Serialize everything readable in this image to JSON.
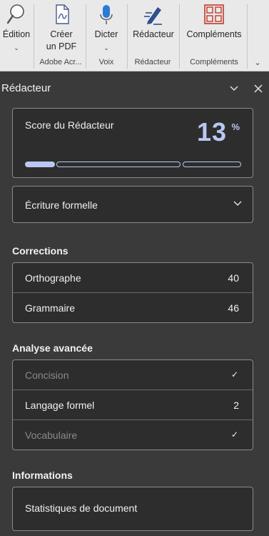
{
  "ribbon": {
    "edition_label": "Édition",
    "create_pdf_label_line1": "Créer",
    "create_pdf_label_line2": "un PDF",
    "dictate_label": "Dicter",
    "editor_label": "Rédacteur",
    "addins_label": "Compléments",
    "groups": {
      "adobe": "Adobe Acr...",
      "voice": "Voix",
      "editor": "Rédacteur",
      "addins": "Compléments"
    }
  },
  "pane": {
    "title": "Rédacteur",
    "score": {
      "label": "Score du Rédacteur",
      "value": "13",
      "unit": "%",
      "progress_fraction": 0.13
    },
    "style_dropdown": {
      "selected": "Écriture formelle"
    },
    "corrections": {
      "title": "Corrections",
      "items": [
        {
          "label": "Orthographe",
          "count": "40"
        },
        {
          "label": "Grammaire",
          "count": "46"
        }
      ]
    },
    "advanced": {
      "title": "Analyse avancée",
      "items": [
        {
          "label": "Concision",
          "status": "✓"
        },
        {
          "label": "Langage formel",
          "count": "2"
        },
        {
          "label": "Vocabulaire",
          "status": "✓"
        }
      ]
    },
    "info": {
      "title": "Informations",
      "items": [
        {
          "label": "Statistiques de document"
        }
      ]
    }
  },
  "colors": {
    "accent": "#b9c8f2",
    "pane_bg": "#3a3a3a",
    "card_bg": "#2d2d2d",
    "ribbon_bg": "#e9e9e9"
  }
}
